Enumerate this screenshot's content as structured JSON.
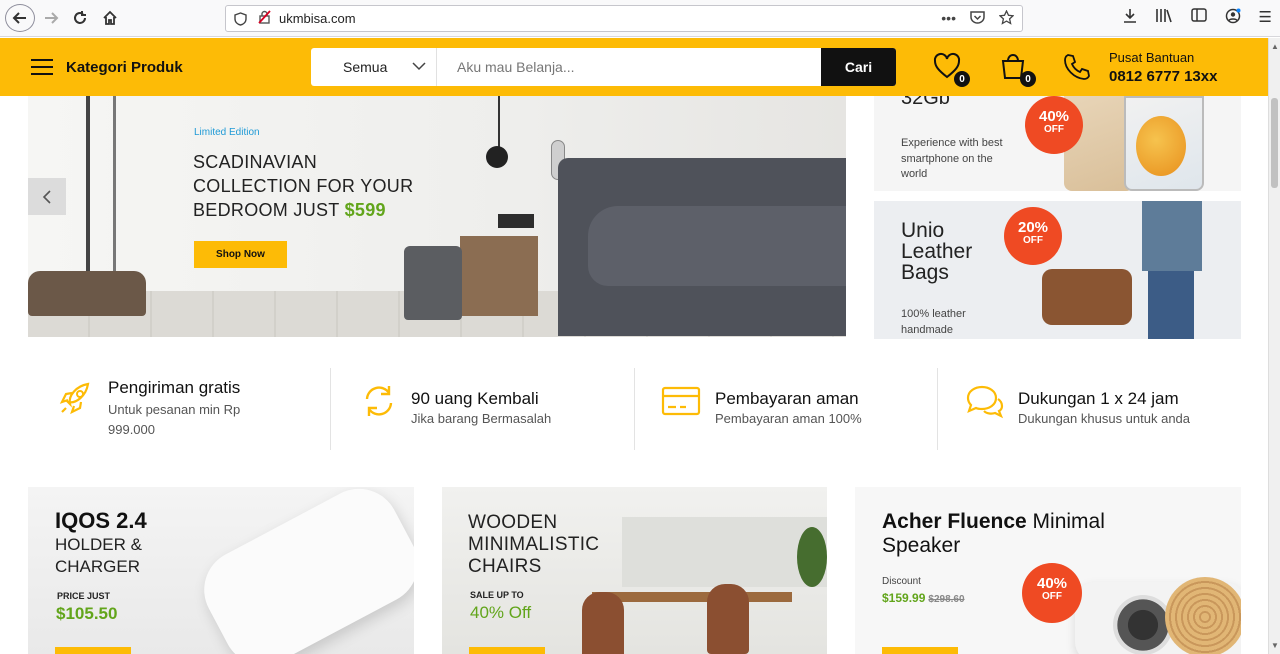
{
  "browser": {
    "url": "ukmbisa.com",
    "menu_icon_glyph": "☰"
  },
  "header": {
    "category_label": "Kategori Produk",
    "search_category": "Semua",
    "search_placeholder": "Aku mau Belanja...",
    "search_button": "Cari",
    "wishlist_count": "0",
    "cart_count": "0",
    "help_title": "Pusat Bantuan",
    "help_phone": "0812 6777 13xx",
    "accent_color": "#fdbb06"
  },
  "hero": {
    "badge": "Limited Edition",
    "title_line1": "SCADINAVIAN",
    "title_line2": "COLLECTION FOR YOUR",
    "title_line3": "BEDROOM JUST",
    "price": "$599",
    "button": "Shop Now"
  },
  "side_banners": [
    {
      "title": "32Gb",
      "description": "Experience with best smartphone on the world",
      "discount_pct": "40%",
      "discount_label": "OFF"
    },
    {
      "title": "Unio Leather Bags",
      "description": "100% leather handmade",
      "discount_pct": "20%",
      "discount_label": "OFF"
    }
  ],
  "features": [
    {
      "title": "Pengiriman gratis",
      "subtitle": "Untuk pesanan min Rp 999.000",
      "icon": "rocket-icon"
    },
    {
      "title": "90 uang Kembali",
      "subtitle": "Jika barang Bermasalah",
      "icon": "refresh-icon"
    },
    {
      "title": "Pembayaran aman",
      "subtitle": "Pembayaran aman 100%",
      "icon": "credit-card-icon"
    },
    {
      "title": "Dukungan 1 x 24 jam",
      "subtitle": "Dukungan khusus untuk anda",
      "icon": "chat-icon"
    }
  ],
  "promos": [
    {
      "title": "IQOS 2.4",
      "subtitle": "HOLDER & CHARGER",
      "price_label": "PRICE JUST",
      "price": "$105.50"
    },
    {
      "title": "WOODEN MINIMALISTIC CHAIRS",
      "sale_label": "SALE UP TO",
      "sale_value": "40% Off"
    },
    {
      "title_bold": "Acher Fluence",
      "title_rest": " Minimal Speaker",
      "discount_label": "Discount",
      "price": "$159.99",
      "old_price": "$298.60",
      "discount_pct": "40%",
      "discount_off": "OFF"
    }
  ]
}
